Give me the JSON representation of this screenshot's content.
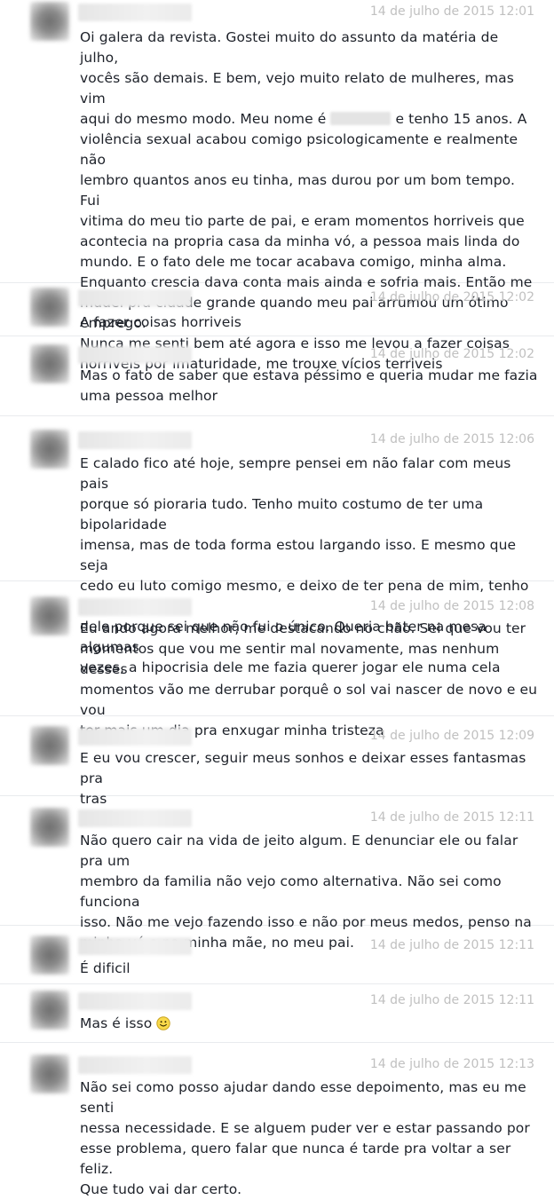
{
  "messages": [
    {
      "time": "14 de julho de 2015 12:01",
      "text_before": "Oi galera da revista. Gostei muito do assunto da matéria de julho,\nvocês são demais. E bem, vejo muito relato de mulheres, mas vim\naqui do mesmo modo. Meu nome é ",
      "text_after": " e tenho 15 anos. A\nviolência sexual acabou comigo psicologicamente e realmente não\nlembro quantos anos eu tinha, mas durou por um bom tempo. Fui\nvitima do meu tio parte de pai, e eram momentos horriveis que\nacontecia na propria casa da minha vó, a pessoa mais linda do\nmundo. E o fato dele me tocar acabava comigo, minha alma.\nEnquanto crescia dava conta mais ainda e sofria mais. Então me\nmudei pra cidade grande quando meu pai arrumou um ótimo emprego.\nNunca me senti bem até agora e isso me levou a fazer coisas\nhorríveis por imaturidade, me trouxe vícios terriveis"
    },
    {
      "time": "14 de julho de 2015 12:02",
      "text": "A fazer coisas horriveis"
    },
    {
      "time": "14 de julho de 2015 12:02",
      "text": "Mas o fato de saber que estava péssimo e queria mudar me fazia\numa pessoa melhor"
    },
    {
      "time": "14 de julho de 2015 12:06",
      "text": "E calado fico até hoje, sempre pensei em não falar com meus pais\nporque só pioraria tudo. Tenho muito costumo de ter uma bipolaridade\nimensa, mas de toda forma estou largando isso. E mesmo que seja\ncedo eu luto comigo mesmo, e deixo de ter pena de mim, tenho pena\ndele porque sei que não fui o único. Queria bater na mesa algumas\nvezes, a hipocrisia dele me fazia querer jogar ele numa cela"
    },
    {
      "time": "14 de julho de 2015 12:08",
      "text": "Eu ando agora melhor, me destacando no chão. Sei que vou ter\nmomentos que vou me sentir mal novamente, mas nenhum desses\nmomentos vão me derrubar porquê o sol vai nascer de novo e eu vou\nter mais um dia pra enxugar minha tristeza"
    },
    {
      "time": "14 de julho de 2015 12:09",
      "text": "E eu vou crescer, seguir meus sonhos e deixar esses fantasmas pra\ntras"
    },
    {
      "time": "14 de julho de 2015 12:11",
      "text": "Não quero cair na vida de jeito algum. E denunciar ele ou falar pra um\nmembro da familia não vejo como alternativa. Não sei como funciona\nisso. Não me vejo fazendo isso e não por meus medos, penso na\nminha vó e na minha mãe, no meu pai."
    },
    {
      "time": "14 de julho de 2015 12:11",
      "text": "É dificil"
    },
    {
      "time": "14 de julho de 2015 12:11",
      "text": "Mas é isso",
      "emoji": "smile-emoji"
    },
    {
      "time": "14 de julho de 2015 12:13",
      "text": "Não sei como posso ajudar dando esse depoimento, mas eu me senti\nnessa necessidade. E se alguem puder ver e estar passando por\nesse problema, quero falar que nunca é tarde pra voltar a ser feliz.\nQue tudo vai dar certo."
    }
  ]
}
